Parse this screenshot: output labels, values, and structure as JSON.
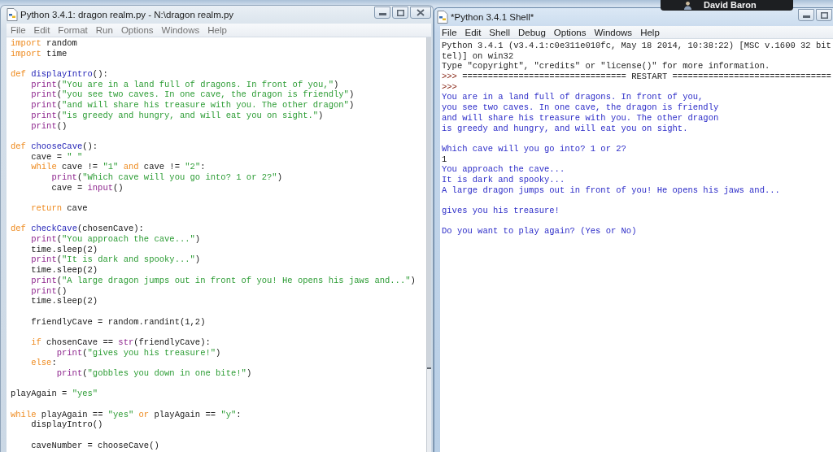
{
  "user_badge": {
    "name": "David Baron"
  },
  "editor_window": {
    "title": "Python 3.4.1: dragon realm.py - N:\\dragon realm.py",
    "active": false,
    "menu": [
      "File",
      "Edit",
      "Format",
      "Run",
      "Options",
      "Windows",
      "Help"
    ],
    "code": {
      "blocks": [
        {
          "lines": [
            {
              "tokens": [
                {
                  "kind": "keyword",
                  "text": "import"
                },
                {
                  "kind": "plain",
                  "text": " random"
                }
              ]
            },
            {
              "tokens": [
                {
                  "kind": "keyword",
                  "text": "import"
                },
                {
                  "kind": "plain",
                  "text": " time"
                }
              ]
            }
          ]
        },
        {
          "lines": [
            {
              "tokens": [
                {
                  "kind": "keyword",
                  "text": "def "
                },
                {
                  "kind": "definition",
                  "text": "displayIntro"
                },
                {
                  "kind": "plain",
                  "text": "():"
                }
              ]
            },
            {
              "tokens": [
                {
                  "kind": "builtin",
                  "text": "    print"
                },
                {
                  "kind": "plain",
                  "text": "("
                },
                {
                  "kind": "string",
                  "text": "\"You are in a land full of dragons. In front of you,\""
                },
                {
                  "kind": "plain",
                  "text": ")"
                }
              ]
            },
            {
              "tokens": [
                {
                  "kind": "builtin",
                  "text": "    print"
                },
                {
                  "kind": "plain",
                  "text": "("
                },
                {
                  "kind": "string",
                  "text": "\"you see two caves. In one cave, the dragon is friendly\""
                },
                {
                  "kind": "plain",
                  "text": ")"
                }
              ]
            },
            {
              "tokens": [
                {
                  "kind": "builtin",
                  "text": "    print"
                },
                {
                  "kind": "plain",
                  "text": "("
                },
                {
                  "kind": "string",
                  "text": "\"and will share his treasure with you. The other dragon\""
                },
                {
                  "kind": "plain",
                  "text": ")"
                }
              ]
            },
            {
              "tokens": [
                {
                  "kind": "builtin",
                  "text": "    print"
                },
                {
                  "kind": "plain",
                  "text": "("
                },
                {
                  "kind": "string",
                  "text": "\"is greedy and hungry, and will eat you on sight.\""
                },
                {
                  "kind": "plain",
                  "text": ")"
                }
              ]
            },
            {
              "tokens": [
                {
                  "kind": "builtin",
                  "text": "    print"
                },
                {
                  "kind": "plain",
                  "text": "()"
                }
              ]
            }
          ]
        },
        {
          "lines": [
            {
              "tokens": [
                {
                  "kind": "keyword",
                  "text": "def "
                },
                {
                  "kind": "definition",
                  "text": "chooseCave"
                },
                {
                  "kind": "plain",
                  "text": "():"
                }
              ]
            },
            {
              "tokens": [
                {
                  "kind": "plain",
                  "text": "    cave = "
                },
                {
                  "kind": "string",
                  "text": "\" \""
                }
              ]
            },
            {
              "tokens": [
                {
                  "kind": "keyword",
                  "text": "    while"
                },
                {
                  "kind": "plain",
                  "text": " cave != "
                },
                {
                  "kind": "string",
                  "text": "\"1\""
                },
                {
                  "kind": "keyword",
                  "text": " and"
                },
                {
                  "kind": "plain",
                  "text": " cave != "
                },
                {
                  "kind": "string",
                  "text": "\"2\""
                },
                {
                  "kind": "plain",
                  "text": ":"
                }
              ]
            },
            {
              "tokens": [
                {
                  "kind": "builtin",
                  "text": "        print"
                },
                {
                  "kind": "plain",
                  "text": "("
                },
                {
                  "kind": "string",
                  "text": "\"Which cave will you go into? 1 or 2?\""
                },
                {
                  "kind": "plain",
                  "text": ")"
                }
              ]
            },
            {
              "tokens": [
                {
                  "kind": "plain",
                  "text": "        cave = "
                },
                {
                  "kind": "builtin",
                  "text": "input"
                },
                {
                  "kind": "plain",
                  "text": "()"
                }
              ]
            }
          ]
        },
        {
          "lines": [
            {
              "tokens": [
                {
                  "kind": "keyword",
                  "text": "    return"
                },
                {
                  "kind": "plain",
                  "text": " cave"
                }
              ]
            }
          ]
        },
        {
          "lines": [
            {
              "tokens": [
                {
                  "kind": "keyword",
                  "text": "def "
                },
                {
                  "kind": "definition",
                  "text": "checkCave"
                },
                {
                  "kind": "plain",
                  "text": "(chosenCave):"
                }
              ]
            },
            {
              "tokens": [
                {
                  "kind": "builtin",
                  "text": "    print"
                },
                {
                  "kind": "plain",
                  "text": "("
                },
                {
                  "kind": "string",
                  "text": "\"You approach the cave...\""
                },
                {
                  "kind": "plain",
                  "text": ")"
                }
              ]
            },
            {
              "tokens": [
                {
                  "kind": "plain",
                  "text": "    time.sleep(2)"
                }
              ]
            },
            {
              "tokens": [
                {
                  "kind": "builtin",
                  "text": "    print"
                },
                {
                  "kind": "plain",
                  "text": "("
                },
                {
                  "kind": "string",
                  "text": "\"It is dark and spooky...\""
                },
                {
                  "kind": "plain",
                  "text": ")"
                }
              ]
            },
            {
              "tokens": [
                {
                  "kind": "plain",
                  "text": "    time.sleep(2)"
                }
              ]
            },
            {
              "tokens": [
                {
                  "kind": "builtin",
                  "text": "    print"
                },
                {
                  "kind": "plain",
                  "text": "("
                },
                {
                  "kind": "string",
                  "text": "\"A large dragon jumps out in front of you! He opens his jaws and...\""
                },
                {
                  "kind": "plain",
                  "text": ")"
                }
              ]
            },
            {
              "tokens": [
                {
                  "kind": "builtin",
                  "text": "    print"
                },
                {
                  "kind": "plain",
                  "text": "()"
                }
              ]
            },
            {
              "tokens": [
                {
                  "kind": "plain",
                  "text": "    time.sleep(2)"
                }
              ]
            }
          ]
        },
        {
          "lines": [
            {
              "tokens": [
                {
                  "kind": "plain",
                  "text": "    friendlyCave = random.randint(1,2)"
                }
              ]
            }
          ]
        },
        {
          "lines": [
            {
              "tokens": [
                {
                  "kind": "keyword",
                  "text": "    if"
                },
                {
                  "kind": "plain",
                  "text": " chosenCave == "
                },
                {
                  "kind": "builtin",
                  "text": "str"
                },
                {
                  "kind": "plain",
                  "text": "(friendlyCave):"
                }
              ]
            },
            {
              "tokens": [
                {
                  "kind": "builtin",
                  "text": "         print"
                },
                {
                  "kind": "plain",
                  "text": "("
                },
                {
                  "kind": "string",
                  "text": "\"gives you his treasure!\""
                },
                {
                  "kind": "plain",
                  "text": ")"
                }
              ]
            },
            {
              "tokens": [
                {
                  "kind": "keyword",
                  "text": "    else"
                },
                {
                  "kind": "plain",
                  "text": ":"
                }
              ]
            },
            {
              "tokens": [
                {
                  "kind": "builtin",
                  "text": "         print"
                },
                {
                  "kind": "plain",
                  "text": "("
                },
                {
                  "kind": "string",
                  "text": "\"gobbles you down in one bite!\""
                },
                {
                  "kind": "plain",
                  "text": ")"
                }
              ]
            }
          ]
        },
        {
          "lines": [
            {
              "tokens": [
                {
                  "kind": "plain",
                  "text": "playAgain = "
                },
                {
                  "kind": "string",
                  "text": "\"yes\""
                }
              ]
            }
          ]
        },
        {
          "lines": [
            {
              "tokens": [
                {
                  "kind": "keyword",
                  "text": "while"
                },
                {
                  "kind": "plain",
                  "text": " playAgain == "
                },
                {
                  "kind": "string",
                  "text": "\"yes\""
                },
                {
                  "kind": "keyword",
                  "text": " or"
                },
                {
                  "kind": "plain",
                  "text": " playAgain == "
                },
                {
                  "kind": "string",
                  "text": "\"y\""
                },
                {
                  "kind": "plain",
                  "text": ":"
                }
              ]
            },
            {
              "tokens": [
                {
                  "kind": "plain",
                  "text": "    displayIntro()"
                }
              ]
            }
          ]
        },
        {
          "lines": [
            {
              "tokens": [
                {
                  "kind": "plain",
                  "text": "    caveNumber = chooseCave()"
                }
              ]
            }
          ]
        }
      ]
    }
  },
  "shell_window": {
    "title": "*Python 3.4.1 Shell*",
    "active": true,
    "menu": [
      "File",
      "Edit",
      "Shell",
      "Debug",
      "Options",
      "Windows",
      "Help"
    ],
    "output": {
      "blocks": [
        {
          "lines": [
            {
              "tokens": [
                {
                  "kind": "console",
                  "text": "Python 3.4.1 (v3.4.1:c0e311e010fc, May 18 2014, 10:38:22) [MSC v.1600 32 bit"
                }
              ]
            },
            {
              "tokens": [
                {
                  "kind": "console",
                  "text": "tel)] on win32"
                }
              ]
            },
            {
              "tokens": [
                {
                  "kind": "console",
                  "text": "Type \"copyright\", \"credits\" or \"license()\" for more information."
                }
              ]
            },
            {
              "tokens": [
                {
                  "kind": "prompt",
                  "text": ">>>"
                },
                {
                  "kind": "console",
                  "text": " ================================ RESTART ==============================="
                }
              ]
            },
            {
              "tokens": [
                {
                  "kind": "prompt",
                  "text": ">>>"
                }
              ]
            },
            {
              "tokens": [
                {
                  "kind": "stdout",
                  "text": "You are in a land full of dragons. In front of you,"
                }
              ]
            },
            {
              "tokens": [
                {
                  "kind": "stdout",
                  "text": "you see two caves. In one cave, the dragon is friendly"
                }
              ]
            },
            {
              "tokens": [
                {
                  "kind": "stdout",
                  "text": "and will share his treasure with you. The other dragon"
                }
              ]
            },
            {
              "tokens": [
                {
                  "kind": "stdout",
                  "text": "is greedy and hungry, and will eat you on sight."
                }
              ]
            }
          ]
        },
        {
          "lines": [
            {
              "tokens": [
                {
                  "kind": "stdout",
                  "text": "Which cave will you go into? 1 or 2?"
                }
              ]
            },
            {
              "tokens": [
                {
                  "kind": "stdin",
                  "text": "1"
                }
              ]
            },
            {
              "tokens": [
                {
                  "kind": "stdout",
                  "text": "You approach the cave..."
                }
              ]
            },
            {
              "tokens": [
                {
                  "kind": "stdout",
                  "text": "It is dark and spooky..."
                }
              ]
            },
            {
              "tokens": [
                {
                  "kind": "stdout",
                  "text": "A large dragon jumps out in front of you! He opens his jaws and..."
                }
              ]
            }
          ]
        },
        {
          "lines": [
            {
              "tokens": [
                {
                  "kind": "stdout",
                  "text": "gives you his treasure!"
                }
              ]
            }
          ]
        },
        {
          "lines": [
            {
              "tokens": [
                {
                  "kind": "stdout",
                  "text": "Do you want to play again? (Yes or No)"
                }
              ]
            }
          ]
        }
      ]
    }
  }
}
